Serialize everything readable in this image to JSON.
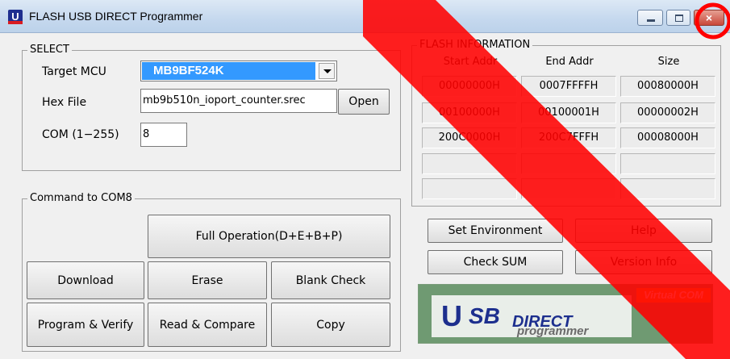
{
  "window": {
    "title": "FLASH USB DIRECT Programmer",
    "icon_letter": "U"
  },
  "select": {
    "title": "SELECT",
    "target_mcu_label": "Target MCU",
    "target_mcu_value": "MB9BF524K",
    "hex_file_label": "Hex File",
    "hex_file_value": "mb9b510n_ioport_counter.srec",
    "open_label": "Open",
    "com_label": "COM (1−255)",
    "com_value": "8"
  },
  "command": {
    "title": "Command to  COM8",
    "full_operation": "Full Operation(D+E+B+P)",
    "download": "Download",
    "erase": "Erase",
    "blank_check": "Blank Check",
    "program_verify": "Program & Verify",
    "read_compare": "Read & Compare",
    "copy": "Copy"
  },
  "flash_info": {
    "title": "FLASH INFORMATION",
    "headers": [
      "Start Addr",
      "End Addr",
      "Size"
    ],
    "rows": [
      [
        "00000000H",
        "0007FFFFH",
        "00080000H"
      ],
      [
        "00100000H",
        "00100001H",
        "00000002H"
      ],
      [
        "200C0000H",
        "200C7FFFH",
        "00008000H"
      ],
      [
        "",
        "",
        ""
      ],
      [
        "",
        "",
        ""
      ]
    ]
  },
  "actions": {
    "set_environment": "Set Environment",
    "help": "Help",
    "check_sum": "Check SUM",
    "version_info": "Version Info"
  },
  "logo": {
    "badge": "Virtual COM",
    "u": "U",
    "sb": "SB",
    "direct": "DIRECT",
    "programmer": "programmer"
  },
  "colors": {
    "selection": "#3399ff",
    "overlay": "#ff0000",
    "logo_blue": "#1d2f8e"
  }
}
